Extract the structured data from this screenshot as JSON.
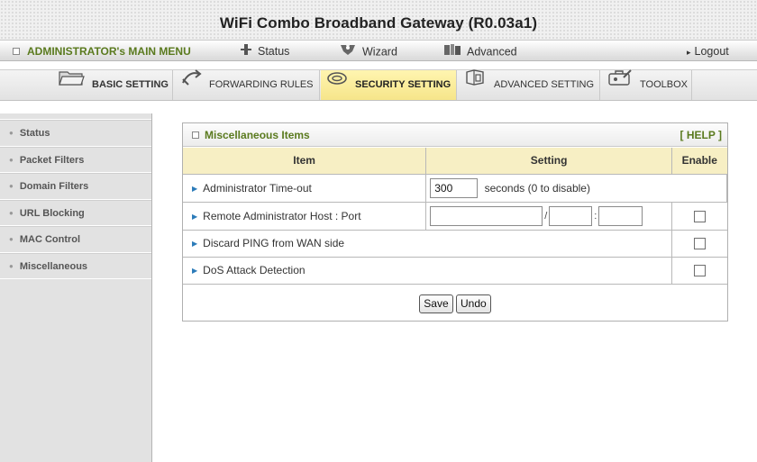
{
  "app": {
    "title": "WiFi Combo Broadband Gateway (R0.03a1)"
  },
  "main_menu": {
    "admin_label": "ADMINISTRATOR's MAIN MENU",
    "status": "Status",
    "wizard": "Wizard",
    "advanced": "Advanced",
    "logout": "Logout"
  },
  "tabs": [
    {
      "label": "BASIC SETTING",
      "icon": "folder-icon"
    },
    {
      "label": "FORWARDING RULES",
      "icon": "forwarding-icon"
    },
    {
      "label": "SECURITY SETTING",
      "icon": "security-icon",
      "active": true
    },
    {
      "label": "ADVANCED SETTING",
      "icon": "advanced-setting-icon"
    },
    {
      "label": "TOOLBOX",
      "icon": "toolbox-icon"
    }
  ],
  "sidebar": {
    "items": [
      {
        "label": "Status"
      },
      {
        "label": "Packet Filters"
      },
      {
        "label": "Domain Filters"
      },
      {
        "label": "URL Blocking"
      },
      {
        "label": "MAC Control"
      },
      {
        "label": "Miscellaneous"
      }
    ]
  },
  "panel": {
    "title": "Miscellaneous Items",
    "help": "[ HELP ]",
    "columns": {
      "item": "Item",
      "setting": "Setting",
      "enable": "Enable"
    },
    "rows": {
      "timeout": {
        "label": "Administrator Time-out",
        "value": "300",
        "suffix": "seconds (0 to disable)"
      },
      "remote": {
        "label": "Remote Administrator Host : Port",
        "host_value": "",
        "mask_value": "",
        "port_value": "",
        "slash": "/",
        "colon": ":",
        "enabled": false
      },
      "ping": {
        "label": "Discard PING from WAN side",
        "enabled": false
      },
      "dos": {
        "label": "DoS Attack Detection",
        "enabled": false
      }
    },
    "buttons": {
      "save": "Save",
      "undo": "Undo"
    }
  },
  "colors": {
    "accent_green": "#5a7a1e",
    "active_tab": "#f6e58a",
    "table_header": "#f7efc4",
    "sidebar_bg": "#e2e2e2"
  }
}
